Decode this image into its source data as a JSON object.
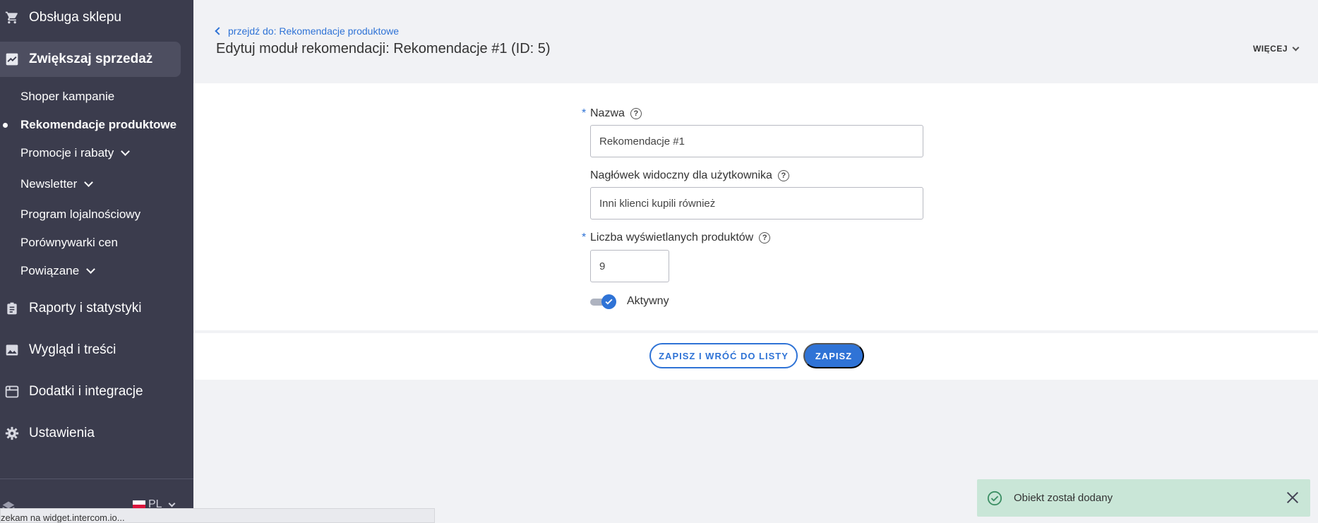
{
  "sidebar": {
    "items": [
      {
        "label": "Obsługa sklepu",
        "icon": "cart-icon"
      },
      {
        "label": "Zwiększaj sprzedaż",
        "icon": "trending-up-icon",
        "active": true
      },
      {
        "label": "Raporty i statystyki",
        "icon": "clipboard-icon"
      },
      {
        "label": "Wygląd i treści",
        "icon": "image-icon"
      },
      {
        "label": "Dodatki i integracje",
        "icon": "calendar-icon"
      },
      {
        "label": "Ustawienia",
        "icon": "gear-icon"
      }
    ],
    "subitems": [
      {
        "label": "Shoper kampanie"
      },
      {
        "label": "Rekomendacje produktowe",
        "current": true
      },
      {
        "label": "Promocje i rabaty",
        "expandable": true
      },
      {
        "label": "Newsletter",
        "expandable": true
      },
      {
        "label": "Program lojalnościowy"
      },
      {
        "label": "Porównywarki cen"
      },
      {
        "label": "Powiązane",
        "expandable": true
      }
    ],
    "language": "PL"
  },
  "header": {
    "back_link": "przejdź do: Rekomendacje produktowe",
    "title": "Edytuj moduł rekomendacji: Rekomendacje #1 (ID: 5)",
    "more_label": "WIĘCEJ"
  },
  "form": {
    "name": {
      "label": "Nazwa",
      "required": "*",
      "value": "Rekomendacje #1"
    },
    "header_field": {
      "label": "Nagłówek widoczny dla użytkownika",
      "value": "Inni klienci kupili również"
    },
    "count": {
      "label": "Liczba wyświetlanych produktów",
      "required": "*",
      "value": "9"
    },
    "active": {
      "label": "Aktywny",
      "checked": true
    }
  },
  "actions": {
    "save_and_back": "ZAPISZ I WRÓĆ DO LISTY",
    "save": "ZAPISZ"
  },
  "toast": {
    "message": "Obiekt został dodany"
  },
  "statusbar": {
    "text": "zekam na widget.intercom.io..."
  },
  "colors": {
    "sidebar_bg": "#3b3c4d",
    "accent": "#2f73d6",
    "toast_bg": "#c9e6d7"
  }
}
